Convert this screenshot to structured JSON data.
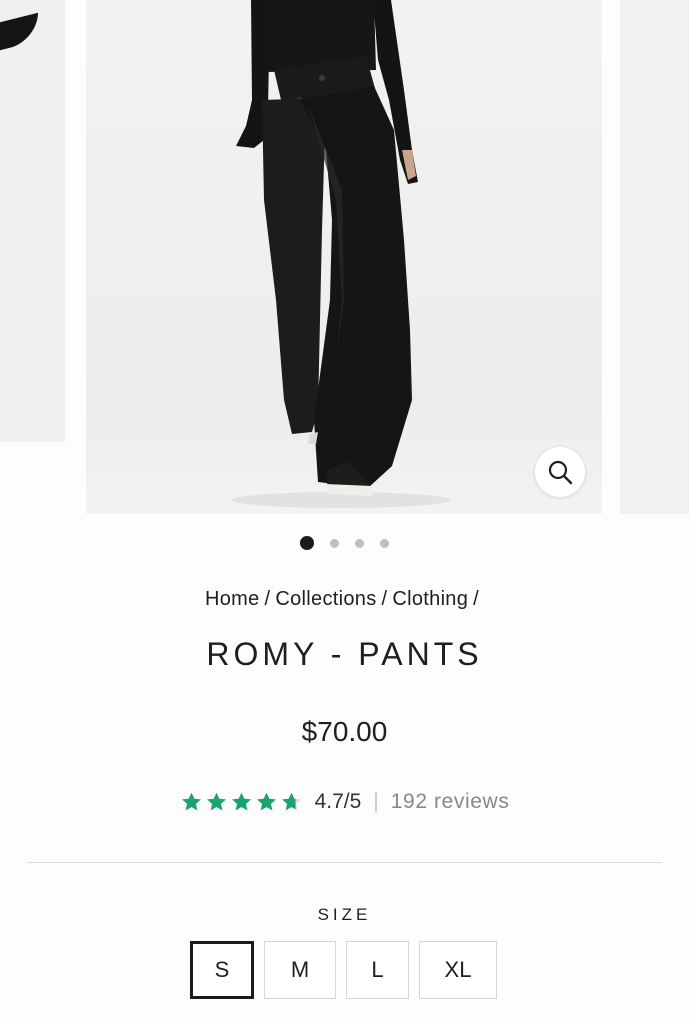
{
  "carousel": {
    "slide_count": 4,
    "active_index": 0,
    "zoom_icon": "magnifier-icon"
  },
  "breadcrumb": {
    "items": [
      "Home",
      "Collections",
      "Clothing"
    ],
    "separator": "/"
  },
  "product": {
    "title": "ROMY - PANTS",
    "price": "$70.00"
  },
  "rating": {
    "stars": 4.7,
    "score_text": "4.7/5",
    "separator": "|",
    "reviews_text": "192 reviews",
    "star_color": "#1aa36a"
  },
  "size": {
    "label": "SIZE",
    "options": [
      "S",
      "M",
      "L",
      "XL"
    ],
    "selected": "S"
  }
}
